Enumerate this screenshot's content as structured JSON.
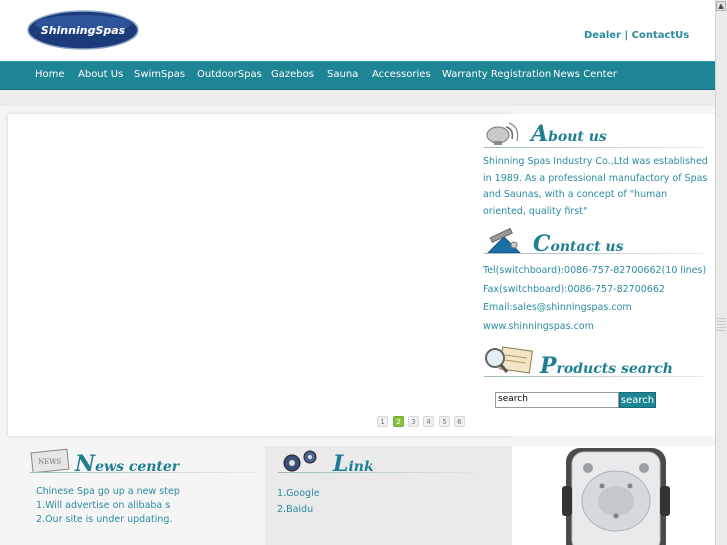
{
  "header": {
    "logo_text": "ShinningSpas",
    "dealer_label": "Dealer",
    "separator": " | ",
    "contact_label": "ContactUs"
  },
  "nav": {
    "items": [
      "Home",
      "About Us",
      "SwimSpas",
      "OutdoorSpas",
      "Gazebos",
      "Sauna",
      "Accessories",
      "Warranty Registration",
      "News Center"
    ]
  },
  "pager": {
    "pages": [
      "1",
      "2",
      "3",
      "4",
      "5",
      "6"
    ],
    "active_index": 1
  },
  "about": {
    "heading_first": "A",
    "heading_rest": "bout us",
    "text": "Shinning Spas Industry Co.,Ltd was established in 1989. As a professional manufactory of Spas and Saunas, with a concept of \"human oriented, quality first\""
  },
  "contact": {
    "heading_first": "C",
    "heading_rest": "ontact us",
    "tel": "Tel(switchboard):0086-757-82700662(10 lines)",
    "fax": "Fax(switchboard):0086-757-82700662",
    "email": "Email:sales@shinningspas.com",
    "web": "www.shinningspas.com"
  },
  "search": {
    "heading_first": "P",
    "heading_rest": "roducts search",
    "input_value": "search",
    "button_label": "search"
  },
  "news": {
    "heading_first": "N",
    "heading_rest": "ews center",
    "items": [
      "Chinese Spa go up a new step",
      "1.Will advertise on alibaba s",
      "2.Our site is under updating."
    ]
  },
  "links": {
    "heading_first": "L",
    "heading_rest": "ink",
    "items": [
      "1.Google",
      "2.Baidu"
    ]
  },
  "colors": {
    "brand": "#1e8594",
    "text_accent": "#2a8ba0",
    "pager_active": "#8ac43f"
  }
}
